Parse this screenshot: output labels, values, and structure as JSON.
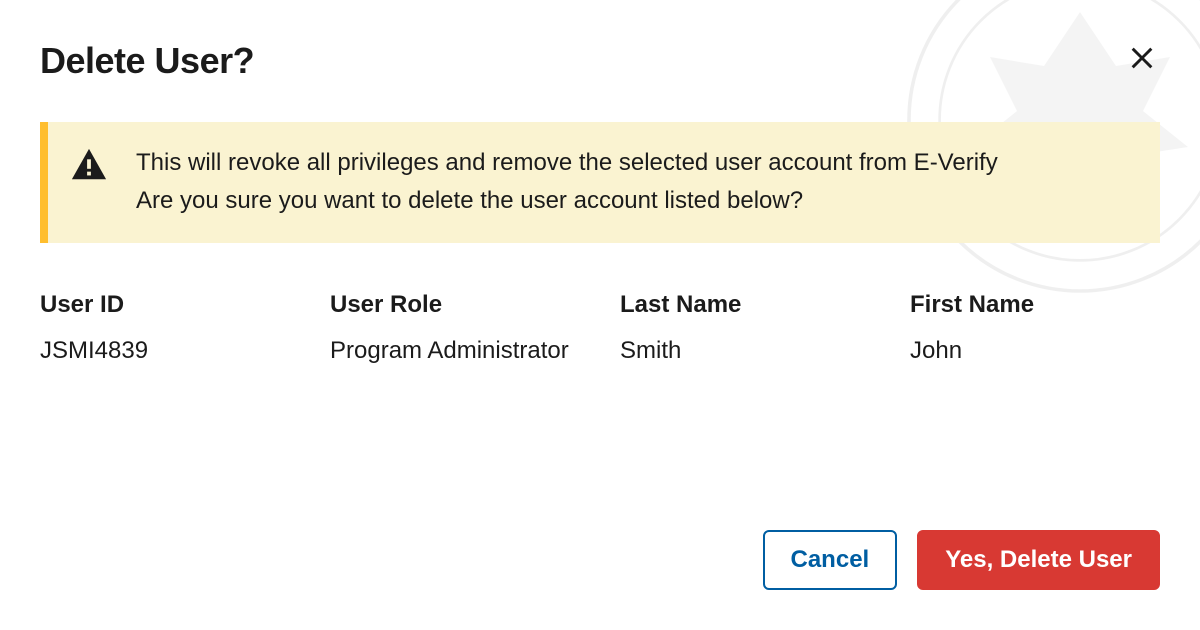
{
  "modal": {
    "title": "Delete User?",
    "alert": {
      "line1": "This will revoke all privileges and remove the selected user account from E-Verify",
      "line2": "Are you sure you want to delete the user account listed below?"
    },
    "fields": {
      "user_id": {
        "label": "User ID",
        "value": "JSMI4839"
      },
      "user_role": {
        "label": "User Role",
        "value": "Program Administrator"
      },
      "last_name": {
        "label": "Last Name",
        "value": "Smith"
      },
      "first_name": {
        "label": "First Name",
        "value": "John"
      }
    },
    "actions": {
      "cancel": "Cancel",
      "confirm": "Yes, Delete User"
    }
  }
}
